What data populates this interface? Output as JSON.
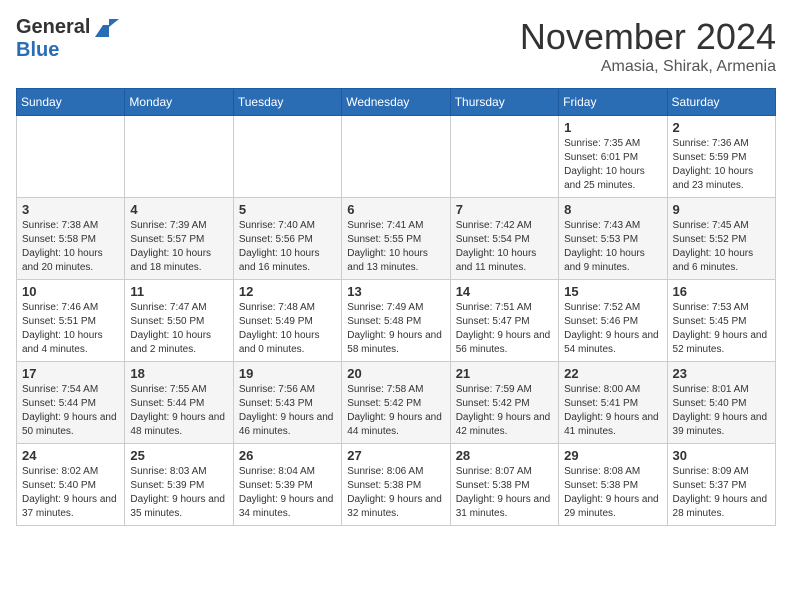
{
  "logo": {
    "general": "General",
    "blue": "Blue"
  },
  "title": "November 2024",
  "location": "Amasia, Shirak, Armenia",
  "weekdays": [
    "Sunday",
    "Monday",
    "Tuesday",
    "Wednesday",
    "Thursday",
    "Friday",
    "Saturday"
  ],
  "weeks": [
    [
      {
        "day": "",
        "info": ""
      },
      {
        "day": "",
        "info": ""
      },
      {
        "day": "",
        "info": ""
      },
      {
        "day": "",
        "info": ""
      },
      {
        "day": "",
        "info": ""
      },
      {
        "day": "1",
        "info": "Sunrise: 7:35 AM\nSunset: 6:01 PM\nDaylight: 10 hours and 25 minutes."
      },
      {
        "day": "2",
        "info": "Sunrise: 7:36 AM\nSunset: 5:59 PM\nDaylight: 10 hours and 23 minutes."
      }
    ],
    [
      {
        "day": "3",
        "info": "Sunrise: 7:38 AM\nSunset: 5:58 PM\nDaylight: 10 hours and 20 minutes."
      },
      {
        "day": "4",
        "info": "Sunrise: 7:39 AM\nSunset: 5:57 PM\nDaylight: 10 hours and 18 minutes."
      },
      {
        "day": "5",
        "info": "Sunrise: 7:40 AM\nSunset: 5:56 PM\nDaylight: 10 hours and 16 minutes."
      },
      {
        "day": "6",
        "info": "Sunrise: 7:41 AM\nSunset: 5:55 PM\nDaylight: 10 hours and 13 minutes."
      },
      {
        "day": "7",
        "info": "Sunrise: 7:42 AM\nSunset: 5:54 PM\nDaylight: 10 hours and 11 minutes."
      },
      {
        "day": "8",
        "info": "Sunrise: 7:43 AM\nSunset: 5:53 PM\nDaylight: 10 hours and 9 minutes."
      },
      {
        "day": "9",
        "info": "Sunrise: 7:45 AM\nSunset: 5:52 PM\nDaylight: 10 hours and 6 minutes."
      }
    ],
    [
      {
        "day": "10",
        "info": "Sunrise: 7:46 AM\nSunset: 5:51 PM\nDaylight: 10 hours and 4 minutes."
      },
      {
        "day": "11",
        "info": "Sunrise: 7:47 AM\nSunset: 5:50 PM\nDaylight: 10 hours and 2 minutes."
      },
      {
        "day": "12",
        "info": "Sunrise: 7:48 AM\nSunset: 5:49 PM\nDaylight: 10 hours and 0 minutes."
      },
      {
        "day": "13",
        "info": "Sunrise: 7:49 AM\nSunset: 5:48 PM\nDaylight: 9 hours and 58 minutes."
      },
      {
        "day": "14",
        "info": "Sunrise: 7:51 AM\nSunset: 5:47 PM\nDaylight: 9 hours and 56 minutes."
      },
      {
        "day": "15",
        "info": "Sunrise: 7:52 AM\nSunset: 5:46 PM\nDaylight: 9 hours and 54 minutes."
      },
      {
        "day": "16",
        "info": "Sunrise: 7:53 AM\nSunset: 5:45 PM\nDaylight: 9 hours and 52 minutes."
      }
    ],
    [
      {
        "day": "17",
        "info": "Sunrise: 7:54 AM\nSunset: 5:44 PM\nDaylight: 9 hours and 50 minutes."
      },
      {
        "day": "18",
        "info": "Sunrise: 7:55 AM\nSunset: 5:44 PM\nDaylight: 9 hours and 48 minutes."
      },
      {
        "day": "19",
        "info": "Sunrise: 7:56 AM\nSunset: 5:43 PM\nDaylight: 9 hours and 46 minutes."
      },
      {
        "day": "20",
        "info": "Sunrise: 7:58 AM\nSunset: 5:42 PM\nDaylight: 9 hours and 44 minutes."
      },
      {
        "day": "21",
        "info": "Sunrise: 7:59 AM\nSunset: 5:42 PM\nDaylight: 9 hours and 42 minutes."
      },
      {
        "day": "22",
        "info": "Sunrise: 8:00 AM\nSunset: 5:41 PM\nDaylight: 9 hours and 41 minutes."
      },
      {
        "day": "23",
        "info": "Sunrise: 8:01 AM\nSunset: 5:40 PM\nDaylight: 9 hours and 39 minutes."
      }
    ],
    [
      {
        "day": "24",
        "info": "Sunrise: 8:02 AM\nSunset: 5:40 PM\nDaylight: 9 hours and 37 minutes."
      },
      {
        "day": "25",
        "info": "Sunrise: 8:03 AM\nSunset: 5:39 PM\nDaylight: 9 hours and 35 minutes."
      },
      {
        "day": "26",
        "info": "Sunrise: 8:04 AM\nSunset: 5:39 PM\nDaylight: 9 hours and 34 minutes."
      },
      {
        "day": "27",
        "info": "Sunrise: 8:06 AM\nSunset: 5:38 PM\nDaylight: 9 hours and 32 minutes."
      },
      {
        "day": "28",
        "info": "Sunrise: 8:07 AM\nSunset: 5:38 PM\nDaylight: 9 hours and 31 minutes."
      },
      {
        "day": "29",
        "info": "Sunrise: 8:08 AM\nSunset: 5:38 PM\nDaylight: 9 hours and 29 minutes."
      },
      {
        "day": "30",
        "info": "Sunrise: 8:09 AM\nSunset: 5:37 PM\nDaylight: 9 hours and 28 minutes."
      }
    ]
  ]
}
